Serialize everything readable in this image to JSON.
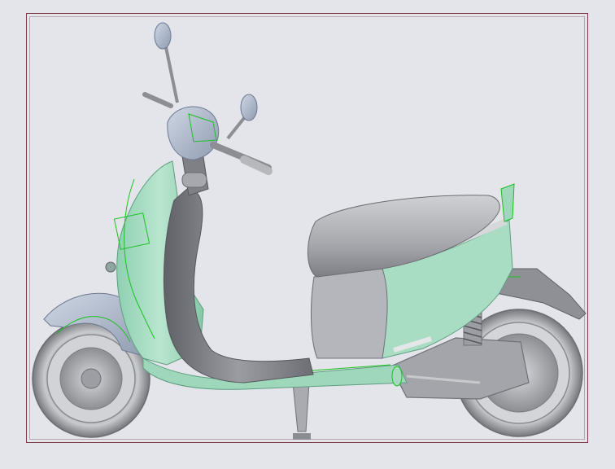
{
  "viewport": {
    "background": "#e4e5ea",
    "frame_color": "#7a3b46"
  },
  "model": {
    "subject": "scooter-model",
    "colors": {
      "body_green": "#a7dcc0",
      "body_green_shade": "#7fc3a2",
      "metal_gray": "#a7a9af",
      "dark_gray": "#6f7177",
      "edge_green": "#19c21f",
      "light_blue": "#b7c4d8"
    }
  }
}
